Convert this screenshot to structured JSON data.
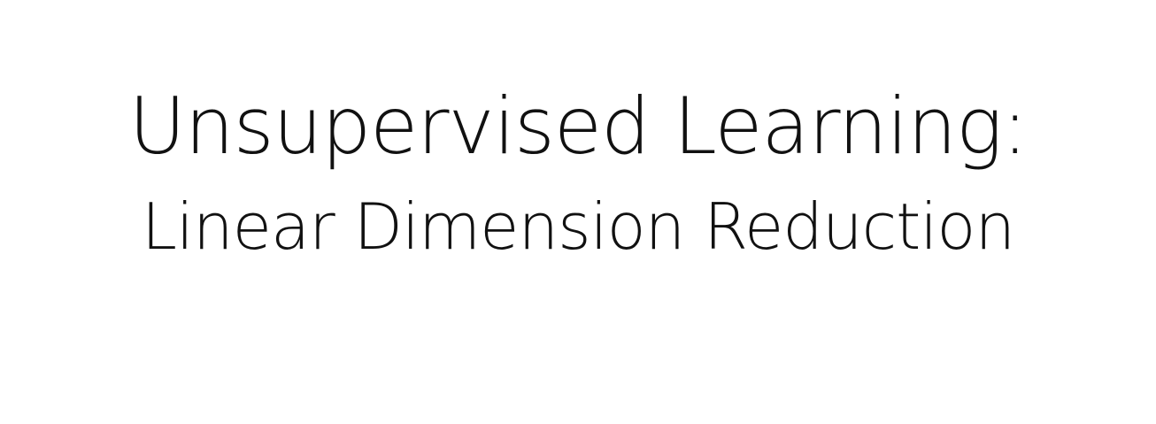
{
  "slide": {
    "title_line_1": "Unsupervised Learning:",
    "title_line_2": "Linear Dimension Reduction"
  }
}
